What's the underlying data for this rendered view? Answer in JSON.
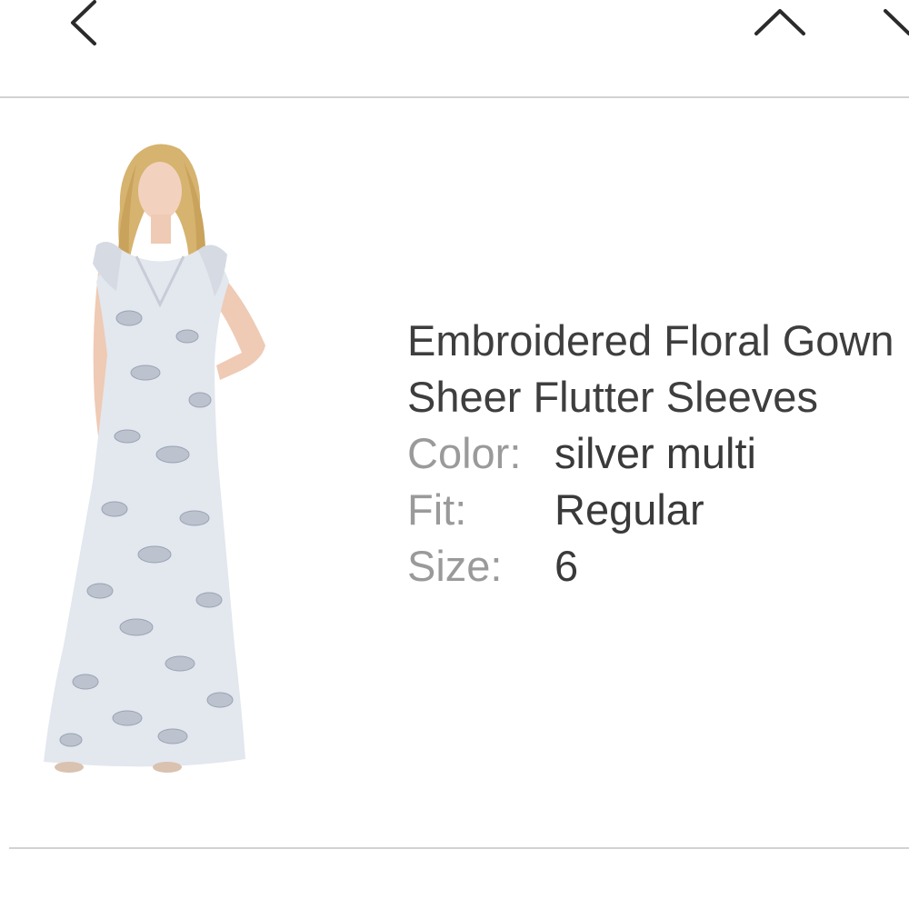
{
  "nav": {
    "back_icon": "chevron-left-icon",
    "prev_icon": "chevron-up-icon",
    "next_icon": "chevron-down-icon"
  },
  "product": {
    "title_line1": "Embroidered Floral Gown",
    "title_line2": "Sheer Flutter Sleeves",
    "attributes": [
      {
        "label": "Color:",
        "value": "silver multi"
      },
      {
        "label": "Fit:",
        "value": "Regular"
      },
      {
        "label": "Size:",
        "value": "6"
      }
    ]
  },
  "colors": {
    "text_dark": "#3a3a3a",
    "text_label": "#9a9a9a",
    "divider": "#d2d2d2",
    "gown": "#e3e7ee"
  }
}
